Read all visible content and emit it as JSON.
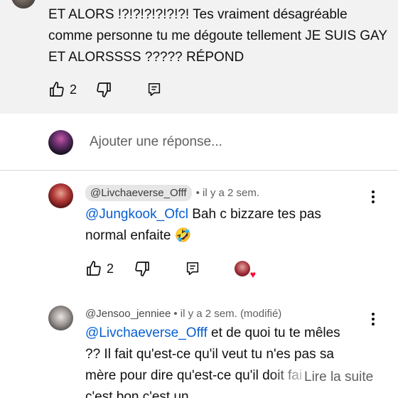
{
  "top_comment": {
    "text": "ET ALORS !?!?!?!?!?!?! Tes vraiment désagréable comme personne tu me dégoute tellement JE SUIS GAY ET ALORSSSS ????? RÉPOND",
    "likes": "2"
  },
  "reply_box": {
    "placeholder": "Ajouter une réponse..."
  },
  "comments": [
    {
      "author": "@Livchaeverse_Offf",
      "time": "• il y a 2 sem.",
      "mention": "@Jungkook_Ofcl",
      "text": " Bah c bizzare tes pas normal enfaite 🤣",
      "likes": "2"
    },
    {
      "author": "@Jensoo_jenniee",
      "time": "• il y a 2 sem. (modifié)",
      "mention": "@Livchaeverse_Offf",
      "text": "  et de quoi tu te mêles ?? Il fait qu'est-ce qu'il veut tu n'es pas sa mère pour dire qu'est-ce qu'il doit faire en fait c'est bon c'est un",
      "read_more": "Lire la suite"
    }
  ],
  "icons": {
    "like": "thumbs-up-icon",
    "dislike": "thumbs-down-icon",
    "reply": "reply-icon",
    "menu": "more-vert-icon",
    "heart": "heart-icon"
  },
  "colors": {
    "mention": "#065fd4",
    "heart": "#ff0033",
    "meta": "#606060"
  }
}
